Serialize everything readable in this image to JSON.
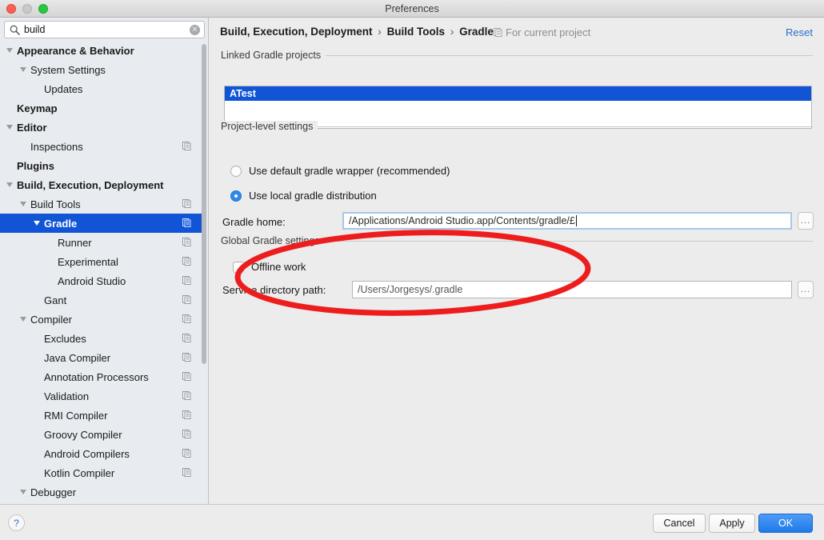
{
  "window": {
    "title": "Preferences",
    "controls": [
      "close",
      "minimize",
      "zoom"
    ]
  },
  "search": {
    "value": "build",
    "placeholder": "",
    "icon": "search-icon",
    "clear_icon": "clear-circle-icon"
  },
  "sidebar": {
    "items": [
      {
        "label": "Appearance & Behavior",
        "indent": 0,
        "arrow": "down",
        "bold": true,
        "selected": false,
        "icon": false
      },
      {
        "label": "System Settings",
        "indent": 1,
        "arrow": "down",
        "bold": false,
        "selected": false,
        "icon": false
      },
      {
        "label": "Updates",
        "indent": 2,
        "arrow": "none",
        "bold": false,
        "selected": false,
        "icon": false
      },
      {
        "label": "Keymap",
        "indent": 0,
        "arrow": "none",
        "bold": true,
        "selected": false,
        "icon": false
      },
      {
        "label": "Editor",
        "indent": 0,
        "arrow": "down",
        "bold": true,
        "selected": false,
        "icon": false
      },
      {
        "label": "Inspections",
        "indent": 1,
        "arrow": "none",
        "bold": false,
        "selected": false,
        "icon": true
      },
      {
        "label": "Plugins",
        "indent": 0,
        "arrow": "none",
        "bold": true,
        "selected": false,
        "icon": false
      },
      {
        "label": "Build, Execution, Deployment",
        "indent": 0,
        "arrow": "down",
        "bold": true,
        "selected": false,
        "icon": false
      },
      {
        "label": "Build Tools",
        "indent": 1,
        "arrow": "down",
        "bold": false,
        "selected": false,
        "icon": true
      },
      {
        "label": "Gradle",
        "indent": 2,
        "arrow": "down",
        "bold": true,
        "selected": true,
        "icon": true
      },
      {
        "label": "Runner",
        "indent": 3,
        "arrow": "none",
        "bold": false,
        "selected": false,
        "icon": true
      },
      {
        "label": "Experimental",
        "indent": 3,
        "arrow": "none",
        "bold": false,
        "selected": false,
        "icon": true
      },
      {
        "label": "Android Studio",
        "indent": 3,
        "arrow": "none",
        "bold": false,
        "selected": false,
        "icon": true
      },
      {
        "label": "Gant",
        "indent": 2,
        "arrow": "none",
        "bold": false,
        "selected": false,
        "icon": true
      },
      {
        "label": "Compiler",
        "indent": 1,
        "arrow": "down",
        "bold": false,
        "selected": false,
        "icon": true
      },
      {
        "label": "Excludes",
        "indent": 2,
        "arrow": "none",
        "bold": false,
        "selected": false,
        "icon": true
      },
      {
        "label": "Java Compiler",
        "indent": 2,
        "arrow": "none",
        "bold": false,
        "selected": false,
        "icon": true
      },
      {
        "label": "Annotation Processors",
        "indent": 2,
        "arrow": "none",
        "bold": false,
        "selected": false,
        "icon": true
      },
      {
        "label": "Validation",
        "indent": 2,
        "arrow": "none",
        "bold": false,
        "selected": false,
        "icon": true
      },
      {
        "label": "RMI Compiler",
        "indent": 2,
        "arrow": "none",
        "bold": false,
        "selected": false,
        "icon": true
      },
      {
        "label": "Groovy Compiler",
        "indent": 2,
        "arrow": "none",
        "bold": false,
        "selected": false,
        "icon": true
      },
      {
        "label": "Android Compilers",
        "indent": 2,
        "arrow": "none",
        "bold": false,
        "selected": false,
        "icon": true
      },
      {
        "label": "Kotlin Compiler",
        "indent": 2,
        "arrow": "none",
        "bold": false,
        "selected": false,
        "icon": true
      },
      {
        "label": "Debugger",
        "indent": 1,
        "arrow": "down",
        "bold": false,
        "selected": false,
        "icon": false
      }
    ]
  },
  "panel": {
    "breadcrumb": [
      "Build, Execution, Deployment",
      "Build Tools",
      "Gradle"
    ],
    "breadcrumb_separator": "›",
    "scope_note": "For current project",
    "scope_icon": "project-scope-icon",
    "reset_label": "Reset",
    "groups": {
      "linked": "Linked Gradle projects",
      "project_level": "Project-level settings",
      "global": "Global Gradle settings"
    },
    "linked_projects": [
      "ATest"
    ],
    "radios": [
      {
        "label": "Use default gradle wrapper (recommended)",
        "selected": false
      },
      {
        "label": "Use local gradle distribution",
        "selected": true
      }
    ],
    "gradle_home": {
      "label": "Gradle home:",
      "value": "/Applications/Android Studio.app/Contents/gradle/£",
      "focused": true,
      "browse_label": "..."
    },
    "offline_work": {
      "label": "Offline work",
      "checked": false
    },
    "service_directory": {
      "label": "Service directory path:",
      "value": "/Users/Jorgesys/.gradle",
      "browse_label": "..."
    }
  },
  "footer": {
    "help_label": "?",
    "cancel_label": "Cancel",
    "apply_label": "Apply",
    "ok_label": "OK"
  },
  "annotation": {
    "shape": "ellipse",
    "color": "#ee1d1d",
    "stroke_width": 7
  },
  "colors": {
    "selection_blue": "#1155d6",
    "accent_blue": "#2a6fcc",
    "sidebar_bg": "#e8ecf0",
    "panel_bg": "#ececec",
    "annotation_red": "#ee1d1d"
  }
}
